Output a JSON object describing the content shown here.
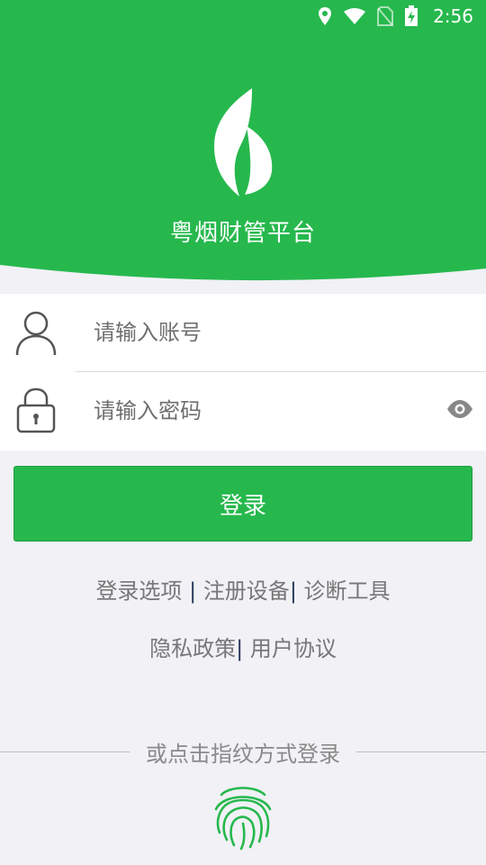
{
  "status_bar": {
    "time": "2:56",
    "icons": [
      "location-icon",
      "wifi-icon",
      "no-sim-icon",
      "battery-charging-icon"
    ]
  },
  "header": {
    "app_title": "粤烟财管平台",
    "logo_icon": "leaf-icon",
    "brand_color": "#26b84d"
  },
  "form": {
    "account_placeholder": "请输入账号",
    "password_placeholder": "请输入密码",
    "user_icon": "user-icon",
    "lock_icon": "lock-icon",
    "eye_icon": "eye-icon"
  },
  "login_button": {
    "label": "登录"
  },
  "links": {
    "login_options": "登录选项",
    "register_device": "注册设备",
    "diagnostic_tools": "诊断工具",
    "privacy_policy": "隐私政策",
    "user_agreement": "用户协议",
    "separator": "|"
  },
  "fingerprint": {
    "label": "或点击指纹方式登录",
    "icon": "fingerprint-icon"
  }
}
